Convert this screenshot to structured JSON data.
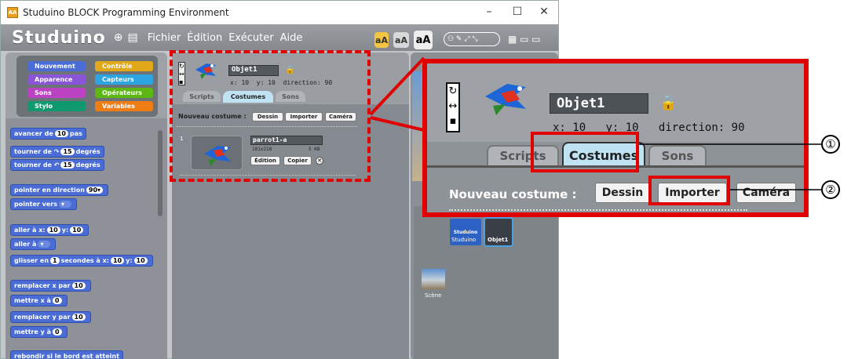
{
  "window": {
    "title": "Studuino BLOCK Programming Environment",
    "app_icon": "studuino-app-icon",
    "controls": {
      "minimize": "–",
      "maximize": "☐",
      "close": "✕"
    }
  },
  "toolbar": {
    "logo": "Studuino",
    "menus": [
      "Fichier",
      "Édition",
      "Exécuter",
      "Aide"
    ],
    "font_sizes": [
      "aA",
      "aA",
      "aA"
    ]
  },
  "categories": {
    "left": [
      "Nouvement",
      "Apparence",
      "Sons",
      "Stylo"
    ],
    "right": [
      "Contrôle",
      "Capteurs",
      "Opérateurs",
      "Variables"
    ]
  },
  "blocks": [
    {
      "pre": "avancer de",
      "n1": "10",
      "post": "pas"
    },
    {
      "pre": "tourner de ↷",
      "n1": "15",
      "post": "degrés"
    },
    {
      "pre": "tourner de ↶",
      "n1": "15",
      "post": "degrés"
    },
    {
      "pre": "pointer en direction",
      "n1": "90▾",
      "post": ""
    },
    {
      "pre": "pointer vers",
      "n1": "▾",
      "post": ""
    },
    {
      "pre": "aller à x:",
      "n1": "10",
      "post": "y:",
      "n2": "10"
    },
    {
      "pre": "aller à",
      "n1": "▾",
      "post": ""
    },
    {
      "pre": "glisser en",
      "n1": "1",
      "post": "secondes à x:",
      "n2": "10",
      "post2": "y:",
      "n3": "10"
    },
    {
      "pre": "remplacer x par",
      "n1": "10",
      "post": ""
    },
    {
      "pre": "mettre x à",
      "n1": "0",
      "post": ""
    },
    {
      "pre": "remplacer y par",
      "n1": "10",
      "post": ""
    },
    {
      "pre": "mettre y à",
      "n1": "0",
      "post": ""
    },
    {
      "pre": "rebondir si le bord est atteint",
      "n1": "",
      "post": ""
    }
  ],
  "sprite": {
    "name": "Objet1",
    "x_label": "x:",
    "x": "10",
    "y_label": "y:",
    "y": "10",
    "direction_label": "direction:",
    "direction": "90"
  },
  "tabs": [
    "Scripts",
    "Costumes",
    "Sons"
  ],
  "costume_bar": {
    "label": "Nouveau costume :",
    "buttons": [
      "Dessin",
      "Importer",
      "Caméra"
    ]
  },
  "costume": {
    "index": "1",
    "name": "parrot1-a",
    "size": "181x218",
    "filesize": "5 KB",
    "buttons": [
      "Édition",
      "Copier"
    ]
  },
  "stage_panel": {
    "label": "Scène",
    "sprites": [
      {
        "name": "Studuino"
      },
      {
        "name": "Objet1"
      }
    ]
  },
  "annotations": [
    "①",
    "②"
  ],
  "colors": {
    "highlight_red": "#e00000",
    "block_blue": "#4a6cd4",
    "selected_tab": "#bfe3f3"
  }
}
